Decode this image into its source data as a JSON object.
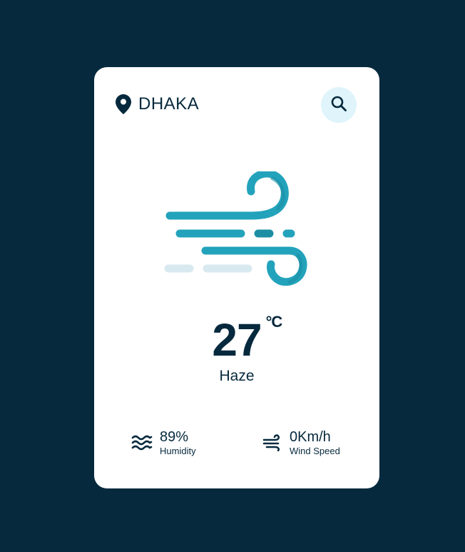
{
  "location": {
    "city": "DHAKA",
    "icon": "map-pin-icon"
  },
  "search": {
    "icon": "search-icon",
    "bg_color": "#dff4fb"
  },
  "weather": {
    "illustration": "wind-icon",
    "temperature": "27",
    "unit": "°C",
    "condition": "Haze"
  },
  "stats": {
    "humidity": {
      "icon": "waves-icon",
      "value": "89%",
      "label": "Humidity"
    },
    "wind": {
      "icon": "wind-speed-icon",
      "value": "0Km/h",
      "label": "Wind Speed"
    }
  },
  "colors": {
    "background": "#06293d",
    "card": "#ffffff",
    "accent": "#23a3bb",
    "accent_dark": "#1b8ea4",
    "muted": "#d9e9f0",
    "text": "#06293d"
  }
}
